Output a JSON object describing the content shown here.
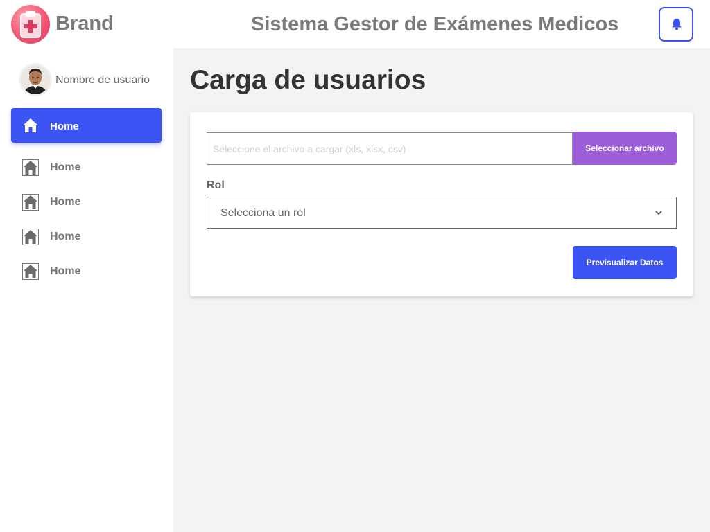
{
  "header": {
    "brand": "Brand",
    "title": "Sistema Gestor de Exámenes Medicos",
    "logo_icon": "clipboard-medical-icon",
    "notification_icon": "bell-icon"
  },
  "sidebar": {
    "user": {
      "name": "Nombre de usuario"
    },
    "items": [
      {
        "label": "Home",
        "icon": "home-icon",
        "active": true
      },
      {
        "label": "Home",
        "icon": "home-icon",
        "active": false
      },
      {
        "label": "Home",
        "icon": "home-icon",
        "active": false
      },
      {
        "label": "Home",
        "icon": "home-icon",
        "active": false
      },
      {
        "label": "Home",
        "icon": "home-icon",
        "active": false
      }
    ]
  },
  "main": {
    "page_title": "Carga de usuarios",
    "file_input": {
      "placeholder": "Seleccione el archivo a cargar (xls, xlsx, csv)",
      "value": ""
    },
    "file_button": "Seleccionar archivo",
    "rol_label": "Rol",
    "rol_select": {
      "selected": "Selecciona un rol"
    },
    "preview_button": "Previsualizar Datos"
  },
  "colors": {
    "accent": "#3d54f5",
    "file_button": "#9b5ed8",
    "logo": "#f25573",
    "background": "#f3f3f3"
  }
}
